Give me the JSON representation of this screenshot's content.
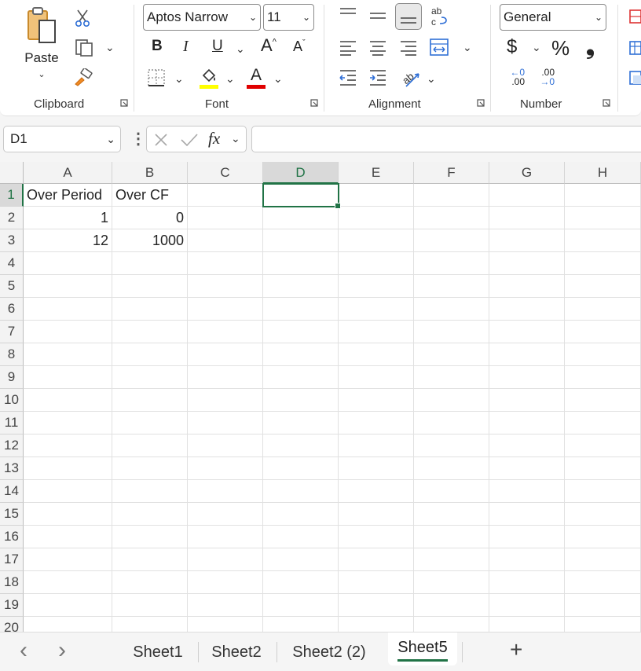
{
  "ribbon": {
    "clipboard": {
      "label": "Clipboard",
      "paste_label": "Paste"
    },
    "font": {
      "label": "Font",
      "font_name": "Aptos Narrow",
      "font_size": "11",
      "bold": "B",
      "italic": "I",
      "underline": "U",
      "grow": "A",
      "shrink": "A",
      "font_color_letter": "A"
    },
    "alignment": {
      "label": "Alignment"
    },
    "number": {
      "label": "Number",
      "format": "General",
      "currency": "$",
      "percent": "%",
      "comma": "❟",
      "inc_decimal_top": "←0",
      "inc_decimal_bottom": ".00",
      "dec_decimal_top": ".00",
      "dec_decimal_bottom": "→0"
    }
  },
  "formula_bar": {
    "name_box": "D1",
    "fx": "fx",
    "formula": ""
  },
  "colors": {
    "accent": "#217346",
    "highlight": "#ffff00",
    "font_color": "#e00000"
  },
  "grid": {
    "columns": [
      "A",
      "B",
      "C",
      "D",
      "E",
      "F",
      "G",
      "H"
    ],
    "rows": [
      "1",
      "2",
      "3",
      "4",
      "5",
      "6",
      "7",
      "8",
      "9",
      "10",
      "11",
      "12",
      "13",
      "14",
      "15",
      "16",
      "17",
      "18",
      "19",
      "20"
    ],
    "cells": {
      "A1": "Over Period",
      "B1": "Over CF",
      "A2": "1",
      "B2": "0",
      "A3": "12",
      "B3": "1000"
    }
  },
  "sheet_tabs": {
    "tabs": [
      "Sheet1",
      "Sheet2",
      "Sheet2 (2)",
      "Sheet5"
    ],
    "active": "Sheet5",
    "add": "+",
    "prev": "‹",
    "next": "›"
  }
}
